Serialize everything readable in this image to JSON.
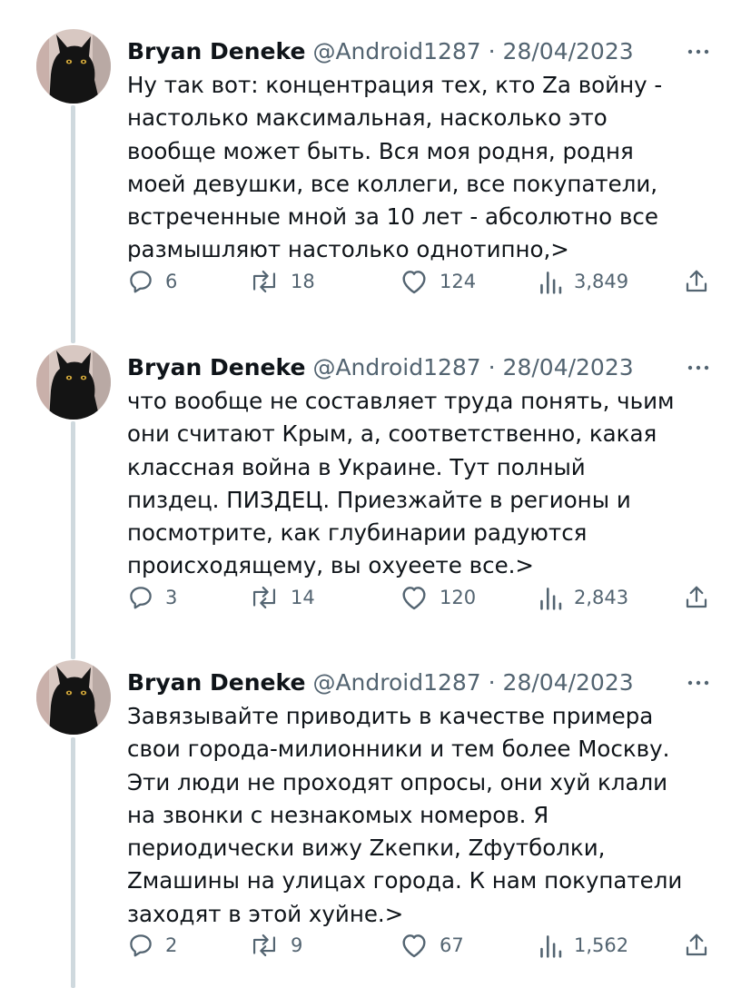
{
  "colors": {
    "text": "#0f1419",
    "muted": "#536471",
    "thread_line": "#cfd9de",
    "background": "#ffffff"
  },
  "tweets": [
    {
      "name": "Bryan Deneke",
      "meta": "@Android1287 · 28/04/2023",
      "text": "Ну так вот: концентрация тех, кто Za войну -\nнастолько максимальная, насколько это\nвообще может быть. Вся моя родня, родня\nмоей девушки, все коллеги, все покупатели,\nвстреченные мной за 10 лет - абсолютно все\nразмышляют настолько однотипно,>",
      "replies": "6",
      "retweets": "18",
      "likes": "124",
      "views": "3,849"
    },
    {
      "name": "Bryan Deneke",
      "meta": "@Android1287 · 28/04/2023",
      "text": "что вообще не составляет труда понять, чьим\nони считают Крым, а, соответственно, какая\nклассная война в Украине. Тут полный\nпиздец. ПИЗДЕЦ. Приезжайте в регионы и\nпосмотрите, как глубинарии радуются\nпроисходящему, вы охуеете все.>",
      "replies": "3",
      "retweets": "14",
      "likes": "120",
      "views": "2,843"
    },
    {
      "name": "Bryan Deneke",
      "meta": "@Android1287 · 28/04/2023",
      "text": "Завязывайте приводить в качестве примера\nсвои города-милионники и тем более Москву.\nЭти люди не проходят опросы, они хуй клали\nна звонки с незнакомых номеров. Я\nпериодически вижу Zкепки, Zфутболки,\nZмашины на улицах города. К нам покупатели\nзаходят в этой хуйне.>",
      "replies": "2",
      "retweets": "9",
      "likes": "67",
      "views": "1,562"
    }
  ]
}
